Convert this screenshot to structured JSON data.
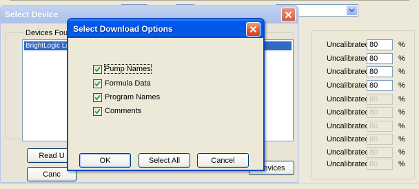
{
  "background_app": {
    "calibration_rows": [
      {
        "status": "Uncalibrated",
        "value": "80",
        "unit": "%",
        "enabled": true
      },
      {
        "status": "Uncalibrated",
        "value": "80",
        "unit": "%",
        "enabled": true
      },
      {
        "status": "Uncalibrated",
        "value": "80",
        "unit": "%",
        "enabled": true
      },
      {
        "status": "Uncalibrated",
        "value": "80",
        "unit": "%",
        "enabled": true
      },
      {
        "status": "Uncalibrated",
        "value": "80",
        "unit": "%",
        "enabled": false
      },
      {
        "status": "Uncalibrated",
        "value": "80",
        "unit": "%",
        "enabled": false
      },
      {
        "status": "Uncalibrated",
        "value": "80",
        "unit": "%",
        "enabled": false
      },
      {
        "status": "Uncalibrated",
        "value": "80",
        "unit": "%",
        "enabled": false
      },
      {
        "status": "Uncalibrated",
        "value": "80",
        "unit": "%",
        "enabled": false
      },
      {
        "status": "Uncalibrated",
        "value": "80",
        "unit": "%",
        "enabled": false
      }
    ]
  },
  "select_device": {
    "title": "Select Device",
    "group_label": "Devices Four",
    "device_item": "BrightLogic La",
    "read_button": "Read U",
    "cancel_button": "Canc",
    "devices_button": "Devices"
  },
  "download_options": {
    "title": "Select Download Options",
    "options": [
      {
        "label": "Pump Names",
        "checked": true,
        "focused": true
      },
      {
        "label": "Formula Data",
        "checked": true,
        "focused": false
      },
      {
        "label": "Program Names",
        "checked": true,
        "focused": false
      },
      {
        "label": "Comments",
        "checked": true,
        "focused": false
      }
    ],
    "ok_button": "OK",
    "select_all_button": "Select All",
    "cancel_button": "Cancel"
  },
  "colors": {
    "xp_title_blue": "#0055e5",
    "inactive_title": "#b6c9ee",
    "close_red": "#e3572f",
    "selection_blue": "#316ac5"
  }
}
